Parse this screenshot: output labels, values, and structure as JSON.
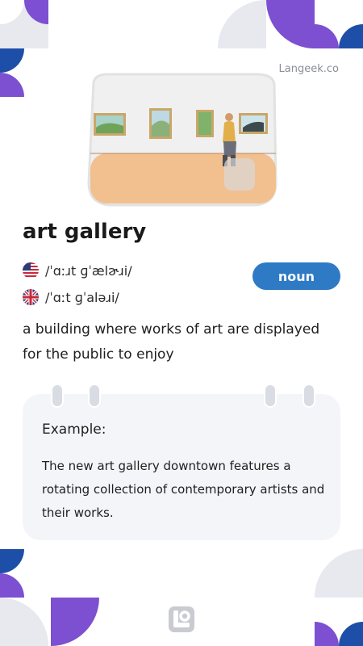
{
  "brand": "Langeek.co",
  "word": "art gallery",
  "pronunciations": {
    "us": "/ˈɑːɹt ɡˈælɚɹi/",
    "uk": "/ˈɑːt ɡˈaləɹi/"
  },
  "part_of_speech": "noun",
  "definition": "a building where works of art are displayed for the public to enjoy",
  "example": {
    "label": "Example:",
    "text": "The new art gallery downtown features a rotating collection of contemporary artists and their works."
  },
  "colors": {
    "accent_blue": "#2e7ac4",
    "purple": "#7d4fd1",
    "dark_blue": "#1e4fa8",
    "light_gray": "#e8e9ef"
  }
}
